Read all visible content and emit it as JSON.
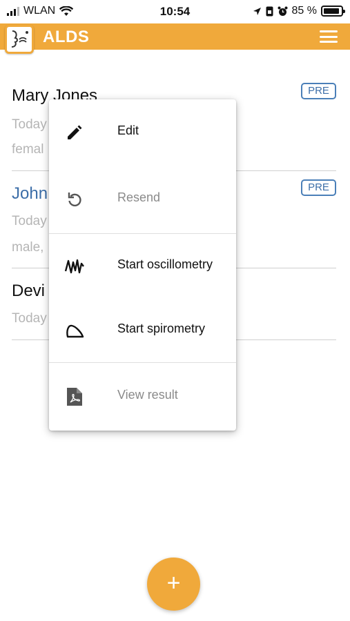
{
  "status_bar": {
    "carrier": "WLAN",
    "time": "10:54",
    "battery_percent": "85 %"
  },
  "app_bar": {
    "title": "ALDS"
  },
  "patients": [
    {
      "name": "Mary Jones",
      "line1": "Today",
      "line2": "femal",
      "badge": "PRE"
    },
    {
      "name": "John",
      "line1": "Today",
      "line2": "male,",
      "badge": "PRE"
    },
    {
      "name": "Devi",
      "line1": "Today"
    }
  ],
  "context_menu": {
    "items": [
      {
        "label": "Edit",
        "icon": "pencil-icon",
        "enabled": true
      },
      {
        "label": "Resend",
        "icon": "resend-icon",
        "enabled": false
      },
      {
        "label": "Start oscillometry",
        "icon": "oscillometry-icon",
        "enabled": true
      },
      {
        "label": "Start spirometry",
        "icon": "spirometry-icon",
        "enabled": true
      },
      {
        "label": "View result",
        "icon": "pdf-icon",
        "enabled": false
      }
    ]
  },
  "fab": {
    "label": "+"
  },
  "colors": {
    "accent": "#f0a93b",
    "link": "#3c6ea8",
    "muted_text": "#b5b5b5",
    "disabled_text": "#8a8a8a"
  }
}
